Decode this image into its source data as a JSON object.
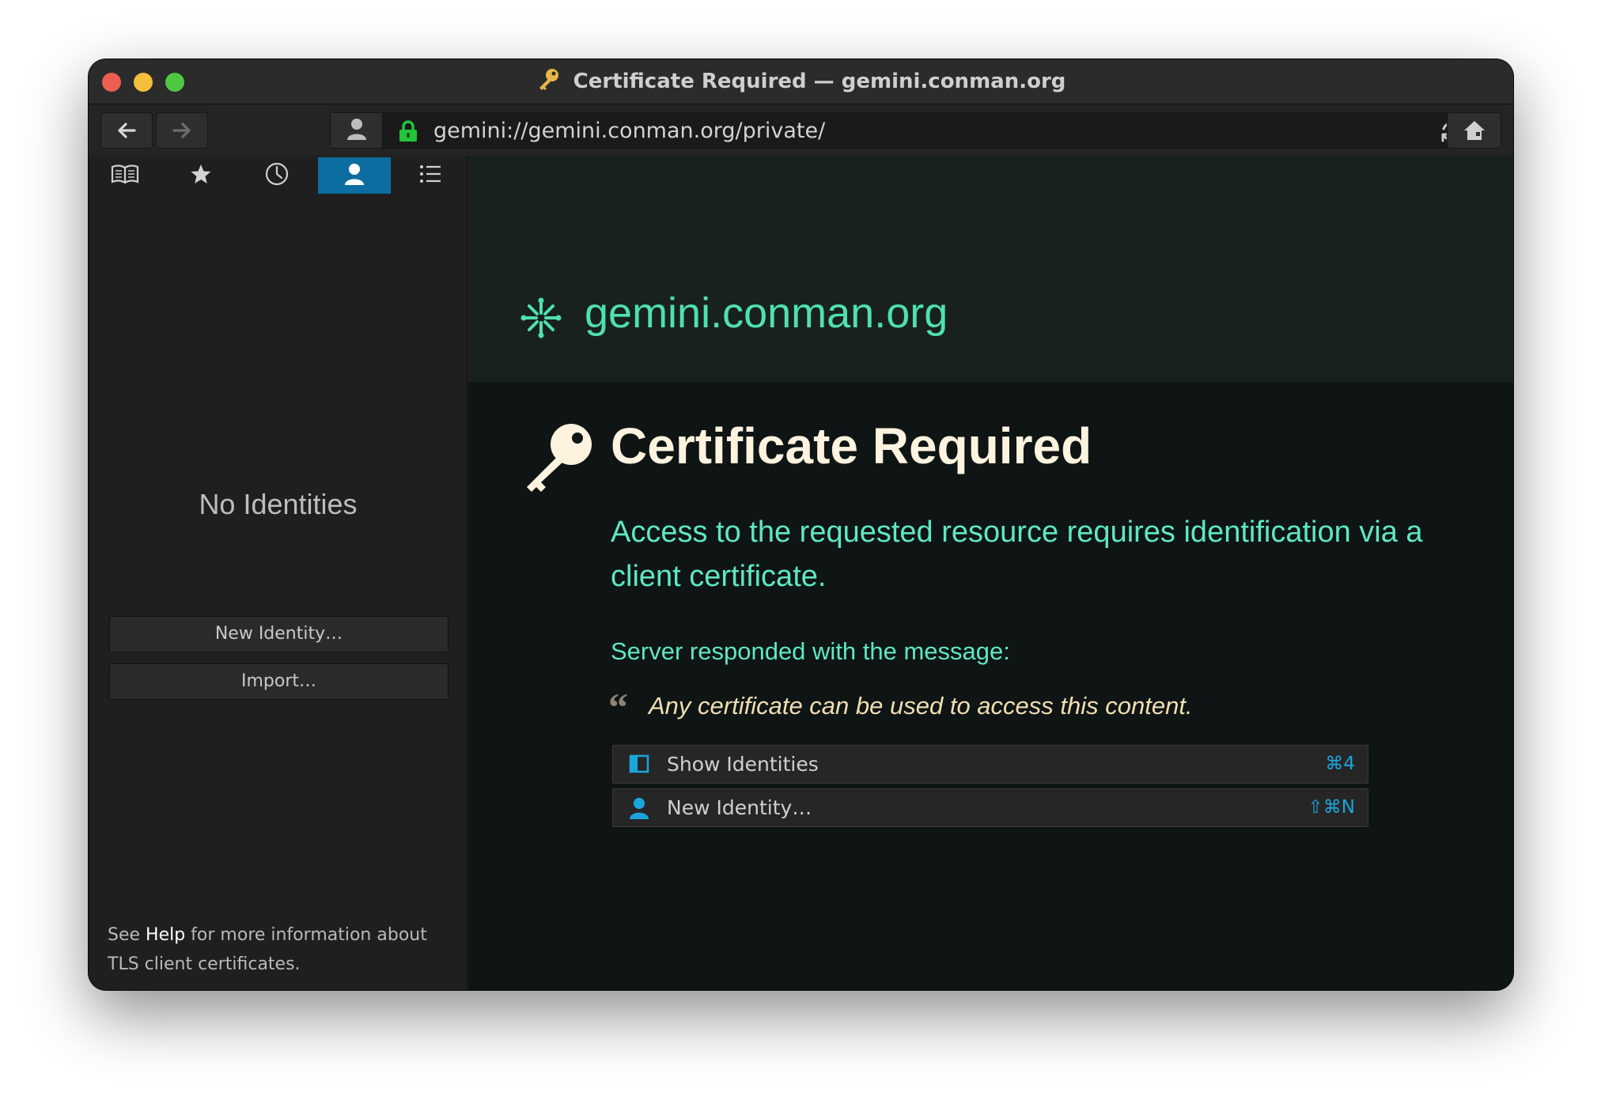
{
  "window": {
    "title": "Certificate Required — gemini.conman.org",
    "title_icon": "key-icon"
  },
  "toolbar": {
    "back_icon": "arrow-left-icon",
    "forward_icon": "arrow-right-icon",
    "identity_icon": "person-icon",
    "lock_icon": "lock-icon",
    "url": "gemini://gemini.conman.org/private/",
    "reload_icon": "reload-icon",
    "home_icon": "home-icon"
  },
  "sidebar": {
    "tabs": [
      {
        "icon": "book-icon",
        "active": false
      },
      {
        "icon": "star-icon",
        "active": false
      },
      {
        "icon": "clock-icon",
        "active": false
      },
      {
        "icon": "person-icon",
        "active": true
      },
      {
        "icon": "list-icon",
        "active": false
      }
    ],
    "empty_title": "No Identities",
    "new_identity_label": "New Identity…",
    "import_label": "Import…",
    "help_prefix": "See ",
    "help_link": "Help",
    "help_suffix": " for more information about TLS client certificates."
  },
  "page": {
    "site_icon": "sparkle-icon",
    "host": "gemini.conman.org",
    "heading_icon": "key-icon",
    "heading": "Certificate Required",
    "lead": "Access to the requested resource requires identification via a client certificate.",
    "server_message_label": "Server responded with the message:",
    "quote_mark": "“",
    "server_message": "Any certificate can be used to access this content.",
    "actions": [
      {
        "icon": "sidebar-icon",
        "label": "Show Identities",
        "shortcut": "⌘4"
      },
      {
        "icon": "person-icon",
        "label": "New Identity…",
        "shortcut": "⇧⌘N"
      }
    ]
  },
  "colors": {
    "accent": "#0c6ea0",
    "host_text": "#4fe0b0",
    "body_text": "#5fe8c0",
    "heading_text": "#fdf3df",
    "quote_text": "#f2deb3",
    "shortcut": "#1aa6dc"
  }
}
